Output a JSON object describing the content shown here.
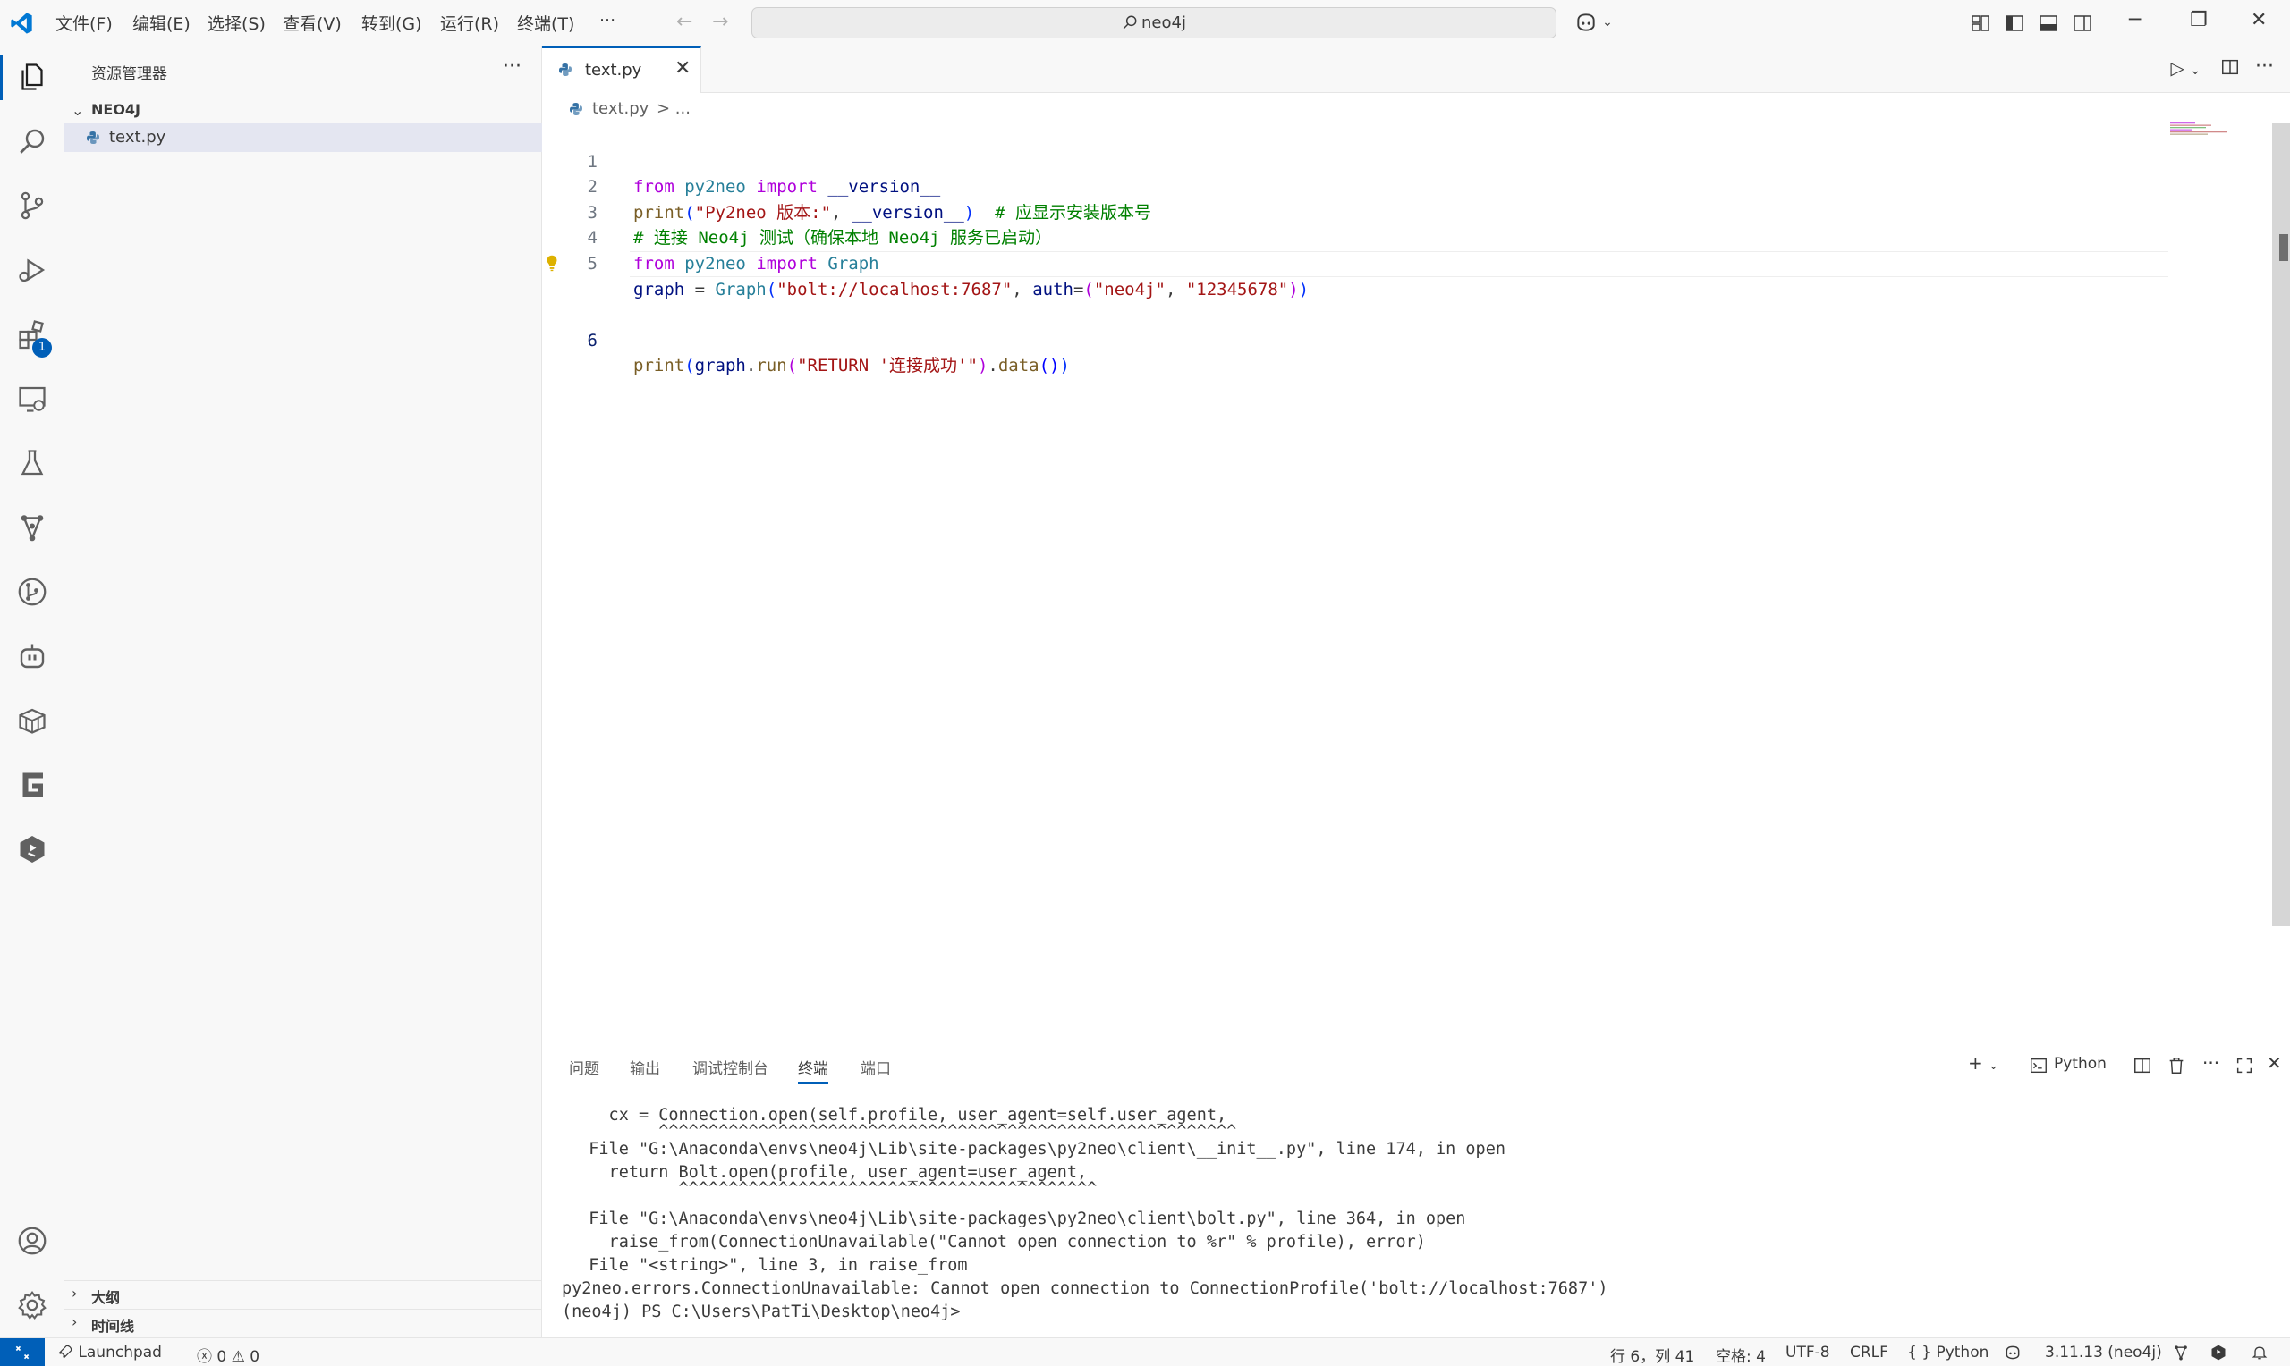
{
  "titlebar": {
    "menu": [
      "文件(F)",
      "编辑(E)",
      "选择(S)",
      "查看(V)",
      "转到(G)",
      "运行(R)",
      "终端(T)",
      "···"
    ],
    "search": "neo4j"
  },
  "activitybar": {
    "extensions_badge": "1"
  },
  "sidebar": {
    "title": "资源管理器",
    "more": "···",
    "folder": "NEO4J",
    "file": "text.py",
    "outline": "大纲",
    "timeline": "时间线"
  },
  "editor": {
    "tab_label": "text.py",
    "breadcrumb_file": "text.py",
    "breadcrumb_rest": "> ...",
    "line_numbers": [
      "1",
      "2",
      "3",
      "4",
      "5",
      "6"
    ],
    "lines": [
      "from py2neo import __version__",
      "print(\"Py2neo 版本:\", __version__)  # 应显示安装版本号",
      "# 连接 Neo4j 测试（确保本地 Neo4j 服务已启动）",
      "from py2neo import Graph",
      "graph = Graph(\"bolt://localhost:7687\", auth=(\"neo4j\", \"12345678\"))",
      "print(graph.run(\"RETURN '连接成功'\").data())"
    ],
    "current_line": 6
  },
  "panel": {
    "tabs": [
      "问题",
      "输出",
      "调试控制台",
      "终端",
      "端口"
    ],
    "active_tab": "终端",
    "shell": "Python",
    "terminal_lines": [
      "    cx = Connection.open(self.profile, user_agent=self.user_agent,",
      "         ^^^^^^^^^^^^^^^^^^^^^^^^^^^^^^^^^^^^^^^^^^^^^^^^^^^^^^^^^^",
      "  File \"G:\\Anaconda\\envs\\neo4j\\Lib\\site-packages\\py2neo\\client\\__init__.py\", line 174, in open",
      "    return Bolt.open(profile, user_agent=user_agent,",
      "           ^^^^^^^^^^^^^^^^^^^^^^^^^^^^^^^^^^^^^^^^^^",
      "  File \"G:\\Anaconda\\envs\\neo4j\\Lib\\site-packages\\py2neo\\client\\bolt.py\", line 364, in open",
      "    raise_from(ConnectionUnavailable(\"Cannot open connection to %r\" % profile), error)",
      "  File \"<string>\", line 3, in raise_from",
      "py2neo.errors.ConnectionUnavailable: Cannot open connection to ConnectionProfile('bolt://localhost:7687')",
      "(neo4j) PS C:\\Users\\PatTi\\Desktop\\neo4j>"
    ]
  },
  "statusbar": {
    "launchpad": "Launchpad",
    "errors": "0",
    "warnings": "0",
    "position": "行 6，列 41",
    "spaces": "空格: 4",
    "encoding": "UTF-8",
    "eol": "CRLF",
    "language": "Python",
    "interpreter": "3.11.13 (neo4j)"
  },
  "colors": {
    "accent": "#005fb8",
    "keyword": "#af00db",
    "string": "#a31515",
    "comment": "#008000",
    "function": "#795e26"
  }
}
